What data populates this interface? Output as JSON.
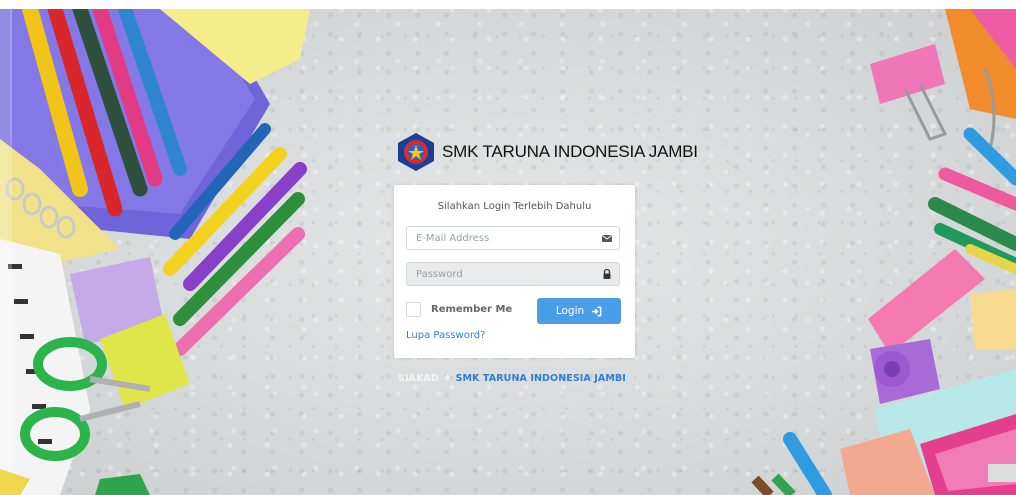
{
  "brand": {
    "school_name": "SMK TARUNA INDONESIA JAMBI",
    "logo_icon": "school-emblem-icon"
  },
  "login": {
    "subtitle": "Silahkan Login Terlebih Dahulu",
    "email": {
      "placeholder": "E-Mail Address",
      "value": "",
      "icon": "envelope-icon"
    },
    "password": {
      "placeholder": "Password",
      "value": "",
      "icon": "lock-icon"
    },
    "remember_label": "Remember Me",
    "remember_checked": false,
    "login_label": "Login",
    "login_icon": "sign-in-icon",
    "forgot_label": "Lupa Password?"
  },
  "footer": {
    "app_name": "SIAKAD",
    "separator": "♦",
    "school_link": "SMK TARUNA INDONESIA JAMBI"
  },
  "colors": {
    "primary": "#4a9ee8",
    "link": "#2d7ed8",
    "card": "#ffffff"
  }
}
